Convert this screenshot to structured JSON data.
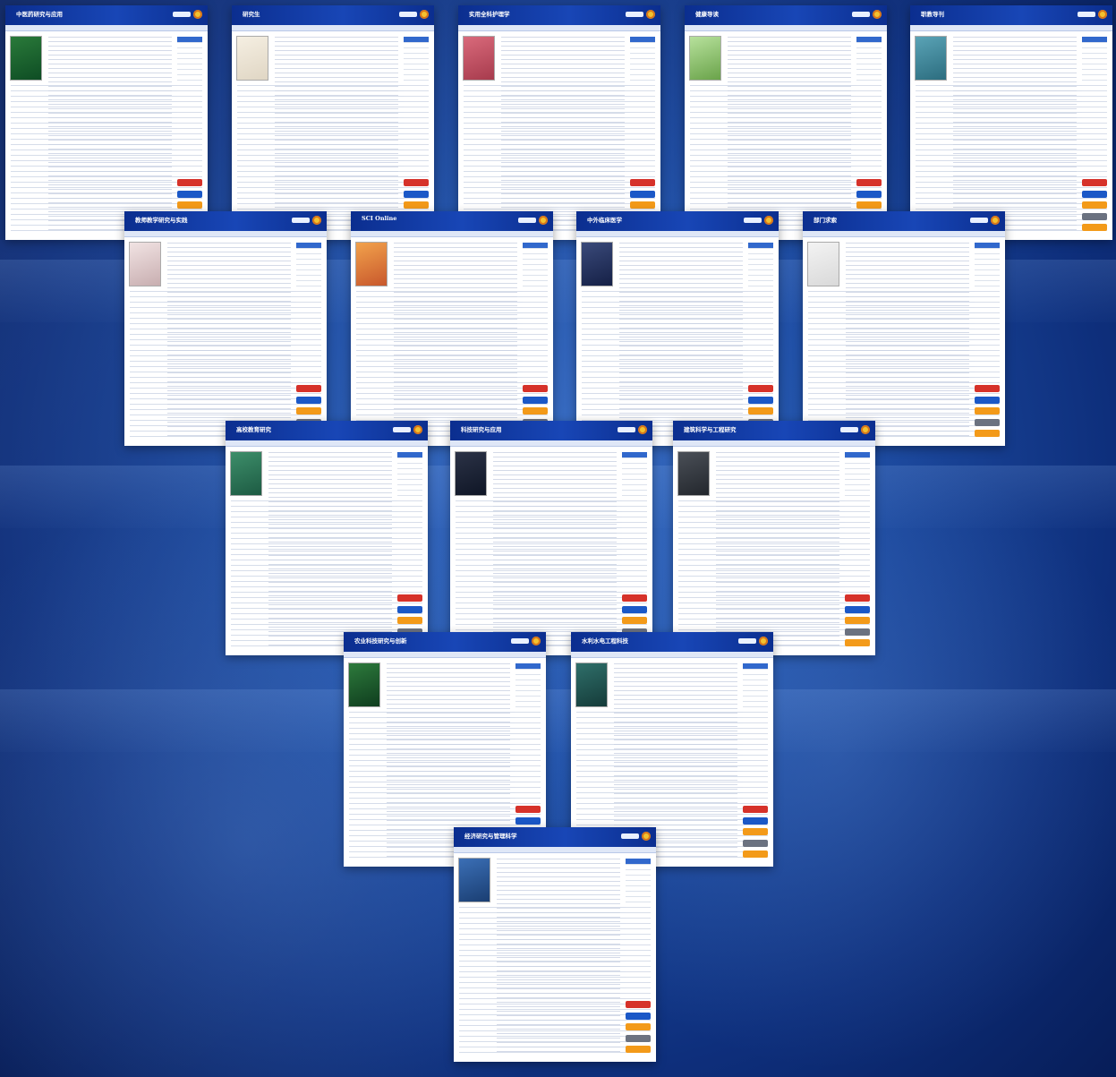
{
  "journals": [
    {
      "title": "中医药研究与应用"
    },
    {
      "title": "研究生"
    },
    {
      "title": "实用全科护理学"
    },
    {
      "title": "健康导读"
    },
    {
      "title": "职教导刊"
    },
    {
      "title": "教师教学研究与实践"
    },
    {
      "title": "SCI Online"
    },
    {
      "title": "中外临床医学"
    },
    {
      "title": "部门求索"
    },
    {
      "title": "高校教育研究"
    },
    {
      "title": "科技研究与应用"
    },
    {
      "title": "建筑科学与工程研究"
    },
    {
      "title": "农业科技研究与创新"
    },
    {
      "title": "水利水电工程科技"
    },
    {
      "title": "经济研究与管理科学"
    }
  ]
}
